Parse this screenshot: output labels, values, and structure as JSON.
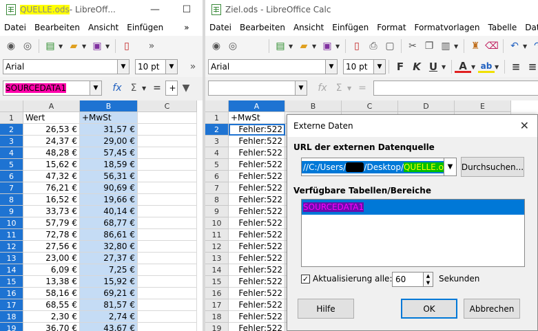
{
  "window_left": {
    "title_highlight": "QUELLE.ods",
    "title_rest": " - LibreOff...",
    "menu": [
      "Datei",
      "Bearbeiten",
      "Ansicht",
      "Einfügen",
      "»"
    ],
    "font_name": "Arial",
    "font_size": "10 pt",
    "name_box": "SOURCEDATA1",
    "columns": [
      "A",
      "B",
      "C"
    ],
    "rows": [
      {
        "n": "1",
        "a": "Wert",
        "b": "+MwSt"
      },
      {
        "n": "2",
        "a": "26,53 €",
        "b": "31,57 €"
      },
      {
        "n": "3",
        "a": "24,37 €",
        "b": "29,00 €"
      },
      {
        "n": "4",
        "a": "48,28 €",
        "b": "57,45 €"
      },
      {
        "n": "5",
        "a": "15,62 €",
        "b": "18,59 €"
      },
      {
        "n": "6",
        "a": "47,32 €",
        "b": "56,31 €"
      },
      {
        "n": "7",
        "a": "76,21 €",
        "b": "90,69 €"
      },
      {
        "n": "8",
        "a": "16,52 €",
        "b": "19,66 €"
      },
      {
        "n": "9",
        "a": "33,73 €",
        "b": "40,14 €"
      },
      {
        "n": "10",
        "a": "57,79 €",
        "b": "68,77 €"
      },
      {
        "n": "11",
        "a": "72,78 €",
        "b": "86,61 €"
      },
      {
        "n": "12",
        "a": "27,56 €",
        "b": "32,80 €"
      },
      {
        "n": "13",
        "a": "23,00 €",
        "b": "27,37 €"
      },
      {
        "n": "14",
        "a": "6,09 €",
        "b": "7,25 €"
      },
      {
        "n": "15",
        "a": "13,38 €",
        "b": "15,92 €"
      },
      {
        "n": "16",
        "a": "58,16 €",
        "b": "69,21 €"
      },
      {
        "n": "17",
        "a": "68,55 €",
        "b": "81,57 €"
      },
      {
        "n": "18",
        "a": "2,30 €",
        "b": "2,74 €"
      },
      {
        "n": "19",
        "a": "36,70 €",
        "b": "43,67 €"
      }
    ]
  },
  "window_right": {
    "title": "Ziel.ods - LibreOffice Calc",
    "menu": [
      "Datei",
      "Bearbeiten",
      "Ansicht",
      "Einfügen",
      "Format",
      "Formatvorlagen",
      "Tabelle",
      "Daten"
    ],
    "font_name": "Arial",
    "font_size": "10 pt",
    "columns": [
      "A",
      "B",
      "C",
      "D",
      "E"
    ],
    "rows": [
      {
        "n": "1",
        "a": "+MwSt"
      },
      {
        "n": "2",
        "a": "Fehler:522"
      },
      {
        "n": "3",
        "a": "Fehler:522"
      },
      {
        "n": "4",
        "a": "Fehler:522"
      },
      {
        "n": "5",
        "a": "Fehler:522"
      },
      {
        "n": "6",
        "a": "Fehler:522"
      },
      {
        "n": "7",
        "a": "Fehler:522"
      },
      {
        "n": "8",
        "a": "Fehler:522"
      },
      {
        "n": "9",
        "a": "Fehler:522"
      },
      {
        "n": "10",
        "a": "Fehler:522"
      },
      {
        "n": "11",
        "a": "Fehler:522"
      },
      {
        "n": "12",
        "a": "Fehler:522"
      },
      {
        "n": "13",
        "a": "Fehler:522"
      },
      {
        "n": "14",
        "a": "Fehler:522"
      },
      {
        "n": "15",
        "a": "Fehler:522"
      },
      {
        "n": "16",
        "a": "Fehler:522"
      },
      {
        "n": "17",
        "a": "Fehler:522"
      },
      {
        "n": "18",
        "a": "Fehler:522"
      },
      {
        "n": "19",
        "a": "Fehler:522"
      }
    ]
  },
  "dialog": {
    "title": "Externe Daten",
    "url_label": "URL der externen Datenquelle",
    "url_prefix": "//C:/Users/",
    "url_mid": "/Desktop/",
    "url_file": "QUELLE.ods",
    "browse": "Durchsuchen...",
    "tables_label": "Verfügbare Tabellen/Bereiche",
    "table_item": "SOURCEDATA1",
    "refresh_label": "Aktualisierung alle:",
    "refresh_value": "60",
    "seconds": "Sekunden",
    "help": "Hilfe",
    "ok": "OK",
    "cancel": "Abbrechen"
  }
}
